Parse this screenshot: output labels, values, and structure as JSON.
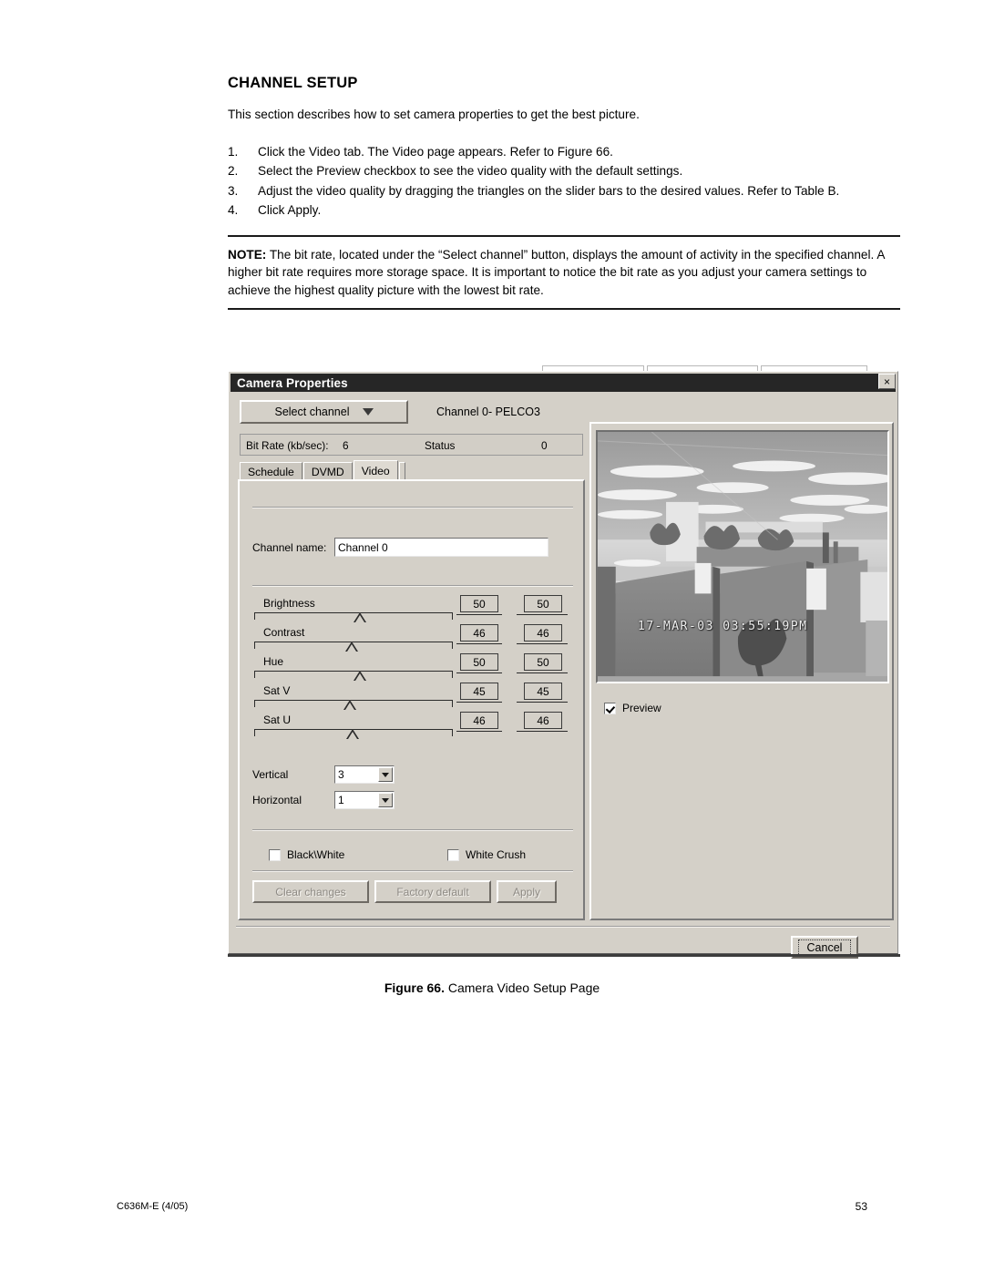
{
  "document": {
    "heading": "CHANNEL SETUP",
    "intro": "This section describes how to set camera properties to get the best picture.",
    "steps": [
      {
        "num": "1.",
        "text": "Click the Video tab. The Video page appears. Refer to Figure 66."
      },
      {
        "num": "2.",
        "text": "Select the Preview checkbox to see the video quality with the default settings."
      },
      {
        "num": "3.",
        "text": "Adjust the video quality by dragging the triangles on the slider bars to the desired values. Refer to Table B."
      },
      {
        "num": "4.",
        "text": "Click Apply."
      }
    ],
    "note": {
      "label": "NOTE:",
      "text": "The bit rate, located under the “Select channel” button, displays the amount of activity in the specified channel. A higher bit rate requires more storage space. It is important to notice the bit rate as you adjust your camera settings to achieve the highest quality picture with the lowest bit rate."
    },
    "figure_caption": {
      "label": "Figure 66.",
      "text": "Camera Video Setup Page"
    },
    "footer": {
      "left": "C636M-E (4/05)",
      "page": "53"
    }
  },
  "dialog": {
    "title": "Camera Properties",
    "close_label": "×",
    "select_channel": {
      "label": "Select channel",
      "icon": "chevron-down-icon"
    },
    "channel_info": "Channel 0- PELCO3",
    "status_strip": {
      "bitrate_label": "Bit Rate (kb/sec):",
      "bitrate_value": "6",
      "status_label": "Status",
      "status_value": "0"
    },
    "tabs": [
      {
        "label": "Schedule",
        "active": false
      },
      {
        "label": "DVMD",
        "active": false
      },
      {
        "label": "Video",
        "active": true
      }
    ],
    "channel_name": {
      "label": "Channel name:",
      "value": "Channel 0"
    },
    "sliders": [
      {
        "label": "Brightness",
        "value": "50",
        "value2": "50",
        "pos_pct": 50
      },
      {
        "label": "Contrast",
        "value": "46",
        "value2": "46",
        "pos_pct": 46
      },
      {
        "label": "Hue",
        "value": "50",
        "value2": "50",
        "pos_pct": 50
      },
      {
        "label": "Sat V",
        "value": "45",
        "value2": "45",
        "pos_pct": 45
      },
      {
        "label": "Sat U",
        "value": "46",
        "value2": "46",
        "pos_pct": 46
      }
    ],
    "selects": [
      {
        "label": "Vertical",
        "value": "3"
      },
      {
        "label": "Horizontal",
        "value": "1"
      }
    ],
    "checkboxes": [
      {
        "label": "Black\\White",
        "checked": false
      },
      {
        "label": "White Crush",
        "checked": false
      }
    ],
    "buttons": [
      {
        "label": "Clear changes",
        "disabled": true
      },
      {
        "label": "Factory default",
        "disabled": true
      },
      {
        "label": "Apply",
        "disabled": true
      }
    ],
    "preview": {
      "checkbox_label": "Preview",
      "checked": true,
      "timestamp": "17-MAR-03 03:55:19PM"
    },
    "cancel_label": "Cancel"
  },
  "colors": {
    "dialog_face": "#d4d0c8",
    "titlebar": "#262626",
    "text": "#000000",
    "disabled_text": "#8e8a84"
  }
}
